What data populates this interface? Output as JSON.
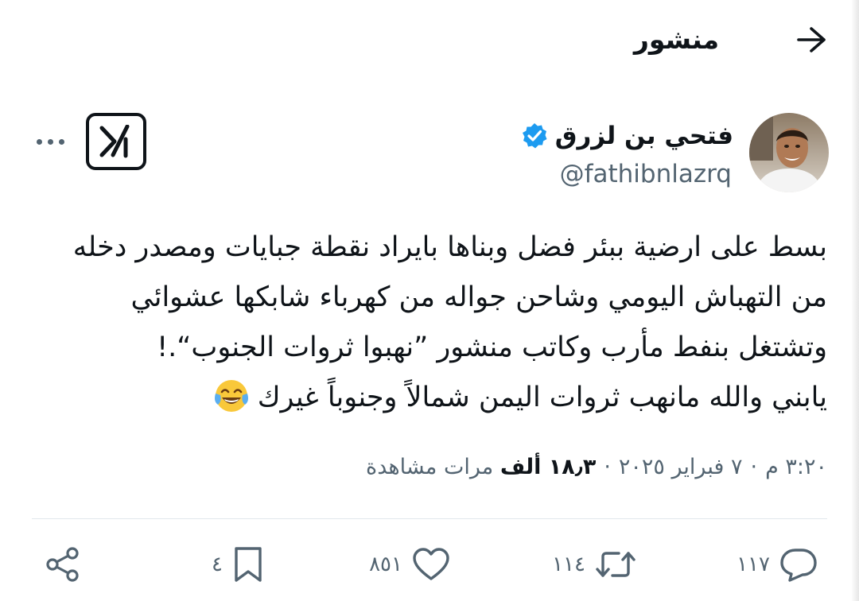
{
  "header": {
    "title": "منشور",
    "back_icon": "arrow-right-icon"
  },
  "author": {
    "name": "فتحي بن لزرق",
    "handle": "@fathibnlazrq",
    "verified_color": "#1d9bf0"
  },
  "tweet": {
    "lines": [
      "بسط على ارضية ببئر فضل وبناها بايراد نقطة جبايات ومصدر دخله",
      "من التهباش اليومي وشاحن جواله من كهرباء شابكها عشوائي",
      "وتشتغل بنفط مأرب وكاتب منشور ”نهبوا ثروات الجنوب“.!",
      "يابني والله مانهب ثروات اليمن شمالاً وجنوباً غيرك"
    ],
    "emoji": "face-with-tears-of-joy"
  },
  "meta": {
    "time": "٣:٢٠ م",
    "date": "٧ فبراير ٢٠٢٥",
    "views_count": "١٨٫٣ ألف",
    "views_label": "مرات مشاهدة",
    "separator": "·"
  },
  "actions": {
    "replies": "١١٧",
    "reposts": "١١٤",
    "likes": "٨٥١",
    "bookmarks": "٤"
  },
  "colors": {
    "text": "#0f1419",
    "secondary": "#536471",
    "accent": "#1d9bf0"
  }
}
